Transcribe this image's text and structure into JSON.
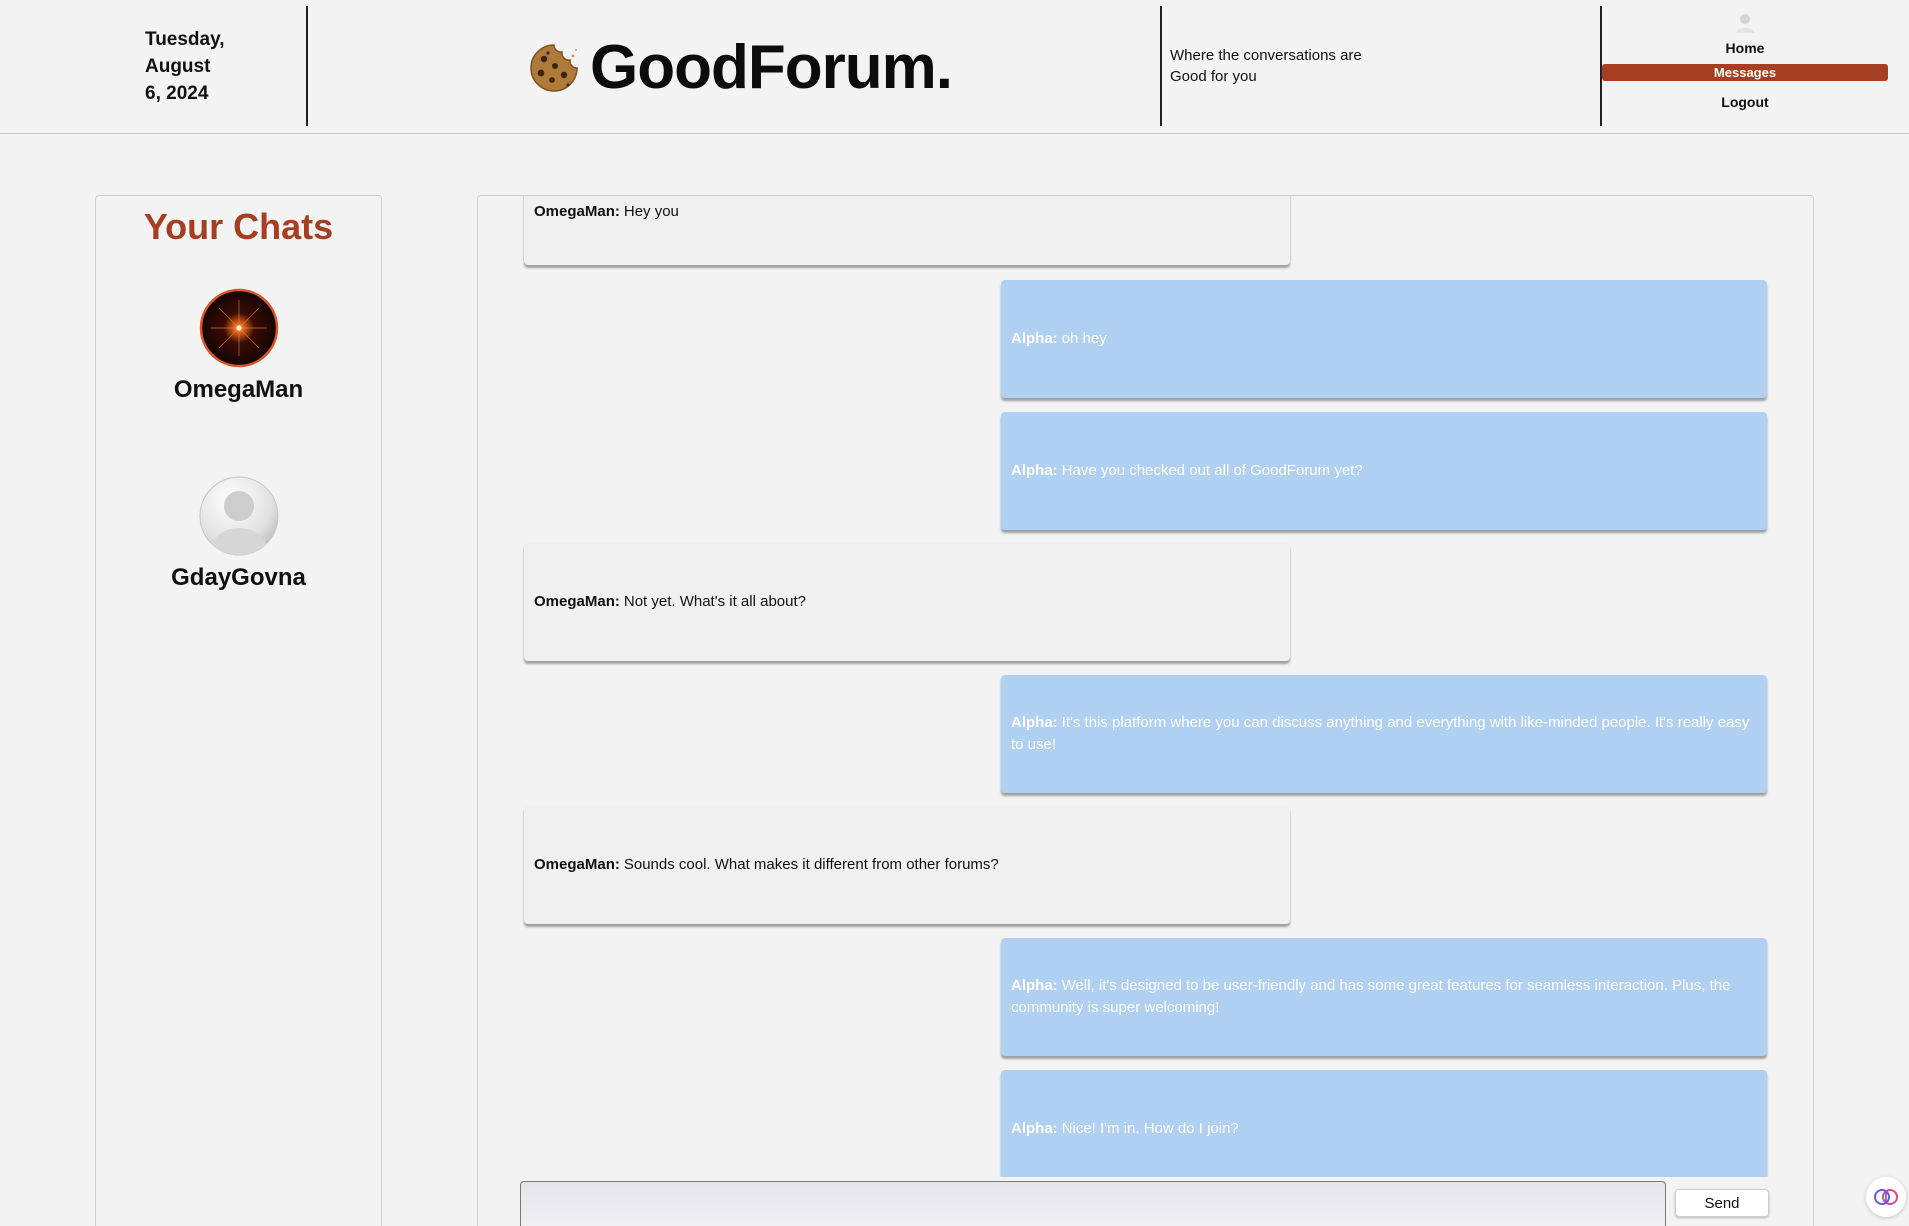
{
  "header": {
    "date_line1": "Tuesday,",
    "date_line2": "August",
    "date_line3": "6, 2024",
    "logo_text": "GoodForum.",
    "tagline_line1": "Where the conversations are",
    "tagline_line2": "Good for you"
  },
  "nav": {
    "home": "Home",
    "messages": "Messages",
    "logout": "Logout",
    "active": "Messages"
  },
  "sidebar": {
    "title": "Your Chats",
    "chats": [
      {
        "name": "OmegaMan",
        "avatar": "starburst-avatar"
      },
      {
        "name": "GdayGovna",
        "avatar": "default-user-avatar"
      }
    ]
  },
  "conversation": {
    "messages": [
      {
        "sender": "OmegaMan:",
        "text": "Hey you",
        "side": "other"
      },
      {
        "sender": "Alpha:",
        "text": "oh hey",
        "side": "mine"
      },
      {
        "sender": "Alpha:",
        "text": "Have you checked out all of GoodForum yet?",
        "side": "mine"
      },
      {
        "sender": "OmegaMan:",
        "text": "Not yet. What's it all about?",
        "side": "other"
      },
      {
        "sender": "Alpha:",
        "text": "It's this platform where you can discuss anything and everything with like-minded people. It's really easy to use!",
        "side": "mine"
      },
      {
        "sender": "OmegaMan:",
        "text": "Sounds cool. What makes it different from other forums?",
        "side": "other"
      },
      {
        "sender": "Alpha:",
        "text": "Well, it's designed to be user-friendly and has some great features for seamless interaction. Plus, the community is super welcoming!",
        "side": "mine"
      },
      {
        "sender": "Alpha:",
        "text": "Nice! I'm in. How do I join?",
        "side": "mine"
      }
    ]
  },
  "composer": {
    "placeholder": "",
    "send_label": "Send"
  },
  "colors": {
    "accent": "#a63f22",
    "my_bubble": "#b0d0f2",
    "other_bubble": "#f0f0f0",
    "background": "#f3f3f3"
  },
  "icons": {
    "logo": "cookie-icon",
    "nav_user": "user-icon",
    "assistant": "brain-icon"
  }
}
